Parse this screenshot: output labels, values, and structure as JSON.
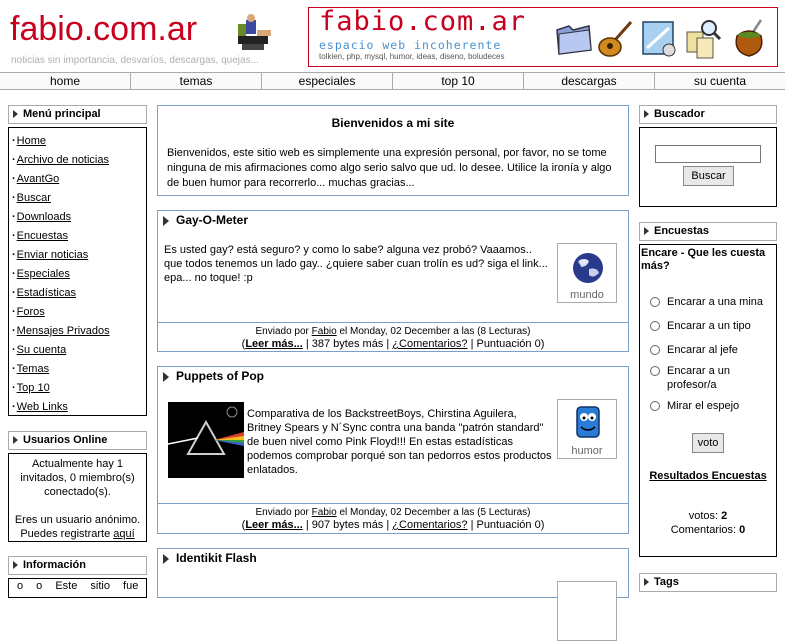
{
  "header": {
    "logo_text": "fabio.com.ar",
    "tagline": "noticias sin importancia, desvaríos, descargas, quejas...",
    "banner_title": "fabio.com.ar",
    "banner_subtitle": "espacio web incoherente",
    "banner_keywords": "tolkien, php, mysql, humor, ideas, diseno, boludeces"
  },
  "nav": [
    "home",
    "temas",
    "especiales",
    "top 10",
    "descargas",
    "su cuenta"
  ],
  "menu": {
    "title": "Menú principal",
    "items": [
      "Home",
      "Archivo de noticias",
      "AvantGo",
      "Buscar",
      "Downloads",
      "Encuestas",
      "Enviar noticias",
      "Especiales",
      "Estadísticas",
      "Foros",
      "Mensajes Privados",
      "Su cuenta",
      "Temas",
      "Top 10",
      "Web Links"
    ]
  },
  "online": {
    "title": "Usuarios Online",
    "line1": "Actualmente hay 1 invitados, 0 miembro(s) conectado(s).",
    "line2": "Eres un usuario anónimo. Puedes registrarte",
    "link": "aquí"
  },
  "info": {
    "title": "Información",
    "text": "o o Este sitio fue"
  },
  "welcome": {
    "title": "Bienvenidos a mi site",
    "text": "Bienvenidos, este sitio web es simplemente una expresión personal, por favor, no se tome ninguna de mis afirmaciones como algo serio salvo que ud. lo desee. Utilice la ironía y algo de buen humor para recorrerlo... muchas gracias..."
  },
  "articles": [
    {
      "title": "Gay-O-Meter",
      "text": "Es usted gay? está seguro? y como lo sabe? alguna vez probó? Vaaamos.. que todos tenemos un lado gay.. ¿quiere saber cuan trolín es ud? siga el link... epa... no toque! :p",
      "topic": "mundo",
      "posted_prefix": "Enviado por",
      "author": "Fabio",
      "posted_suffix": "el Monday, 02 December a las (8 Lecturas)",
      "read_more": "Leer más...",
      "bytes": "| 387 bytes más |",
      "comments": "¿Comentarios?",
      "score": "| Puntuación 0)"
    },
    {
      "title": "Puppets of Pop",
      "text": "Comparativa de los BackstreetBoys, Chirstina Aguilera, Britney Spears y N´Sync contra una banda \"patrón standard\" de buen nivel como Pink Floyd!!! En estas estadísticas podemos comprobar porqué son tan pedorros estos productos enlatados.",
      "topic": "humor",
      "posted_prefix": "Enviado por",
      "author": "Fabio",
      "posted_suffix": "el Monday, 02 December a las (5 Lecturas)",
      "read_more": "Leer más...",
      "bytes": "| 907 bytes más |",
      "comments": "¿Comentarios?",
      "score": "| Puntuación 0)"
    },
    {
      "title": "Identikit Flash"
    }
  ],
  "search": {
    "title": "Buscador",
    "button": "Buscar",
    "value": ""
  },
  "poll": {
    "title": "Encuestas",
    "question": "Encare - Que les cuesta más?",
    "options": [
      "Encarar a una mina",
      "Encarar a un tipo",
      "Encarar al jefe",
      "Encarar a un profesor/a",
      "Mirar el espejo"
    ],
    "vote_button": "voto",
    "results_link": "Resultados Encuestas",
    "votes_label": "votos:",
    "votes": "2",
    "comments_label": "Comentarios:",
    "comments": "0"
  },
  "tags": {
    "title": "Tags"
  }
}
